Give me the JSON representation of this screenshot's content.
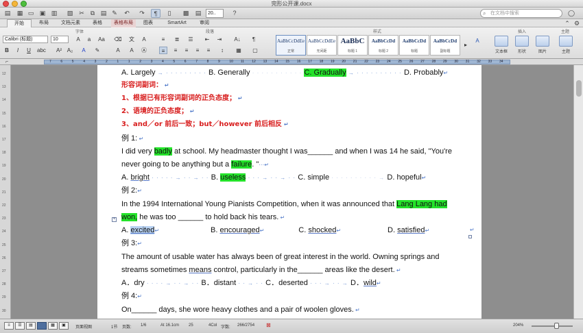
{
  "window": {
    "title": "完形公开课.docx"
  },
  "toolbar": {
    "zoom": "20..",
    "search_placeholder": "在文档中搜索"
  },
  "tabs": [
    "开始",
    "布局",
    "文档元素",
    "表格",
    "表格布局",
    "图表",
    "SmartArt",
    "审阅"
  ],
  "ribbon": {
    "group_font": "字体",
    "group_paragraph": "段落",
    "group_styles": "样式",
    "group_insert": "插入",
    "group_theme": "主题",
    "font_name": "Calibri (标题)",
    "font_size": "10",
    "styles": [
      {
        "sample": "AaBbCcDdEe",
        "name": "正常"
      },
      {
        "sample": "AaBbCcDdEe",
        "name": "无间距"
      },
      {
        "sample": "AaBbC",
        "name": "标题 1"
      },
      {
        "sample": "AaBbCcDd",
        "name": "标题 2"
      },
      {
        "sample": "AaBbCcDd",
        "name": "标题"
      },
      {
        "sample": "AaBbCcDd",
        "name": "副标题"
      }
    ],
    "insert_items": [
      {
        "label": "文本框"
      },
      {
        "label": "形状"
      },
      {
        "label": "图片"
      },
      {
        "label": "主题"
      }
    ]
  },
  "ruler_numbers": [
    "7",
    "6",
    "5",
    "4",
    "3",
    "2",
    "1",
    "1",
    "2",
    "3",
    "4",
    "5",
    "6",
    "7",
    "8",
    "9",
    "10",
    "11",
    "12",
    "13",
    "14",
    "15",
    "16",
    "17",
    "18",
    "19",
    "20",
    "21",
    "22",
    "23",
    "24",
    "25",
    "26",
    "27",
    "28",
    "29",
    "30",
    "31",
    "32",
    "33",
    "34"
  ],
  "vruler_numbers": [
    "12",
    "13",
    "14",
    "15",
    "16",
    "17",
    "18",
    "19",
    "20",
    "21",
    "22",
    "23",
    "24",
    "25",
    "26",
    "27",
    "28",
    "29",
    "30"
  ],
  "doc": {
    "l1": {
      "a": "A. Largely",
      "b": "B. Generally",
      "c": "C. Gradually",
      "d": "D. Probably"
    },
    "h1": "形容词副词：",
    "h2": "1、根据已有形容词副词的正负态度；",
    "h3": "2、语境的正负态度；",
    "h4": "3、and／or 前后一致；but／however 前后相反",
    "ex1": "例 1:",
    "p1a": "I did very ",
    "p1b": "badly",
    "p1c": " at school. My headmaster thought I was______ and when I was 14 he said, \"You're",
    "p2a": "never going to be anything but a ",
    "p2b": "failure",
    "p2c": ". \"",
    "o1": {
      "a1": "A. ",
      "a2": "bright",
      "b1": "B. ",
      "b2": "useless",
      "c": "C. simple",
      "d": "D. hopeful"
    },
    "ex2": "例 2:",
    "p3a": "In the 1994 International Young Pianists Competition, when it was announced that ",
    "p3b": "Lang Lang had",
    "p4a": "won,",
    "p4b": " he was too ______ to hold back his tears.",
    "o2": {
      "a1": "A. ",
      "a2": "excited",
      "b1": "B. ",
      "b2": "encouraged",
      "c1": "C. ",
      "c2": "shocked",
      "d1": "D. ",
      "d2": "satisfied"
    },
    "ex3": "例 3:",
    "p5": "The amount of usable water has always been of great interest in the world. Owning springs and",
    "p6a": "streams sometimes ",
    "p6b": "means",
    "p6c": " control, particularly in the______ areas like the desert.",
    "o3": {
      "a": "A．dry",
      "b": "B．distant",
      "c": "C．deserted",
      "d1": "D．",
      "d2": "wild"
    },
    "ex4": "例 4:",
    "p7": "On______ days, she wore heavy clothes and a pair of woolen gloves."
  },
  "status": {
    "view": "页面视图",
    "section": "1节",
    "page_label": "页数:",
    "page": "1/6",
    "position": "At 16.1cm",
    "line": "25",
    "col": "4Col",
    "words_label": "字数:",
    "words": "266/2754",
    "zoom": "204%"
  }
}
